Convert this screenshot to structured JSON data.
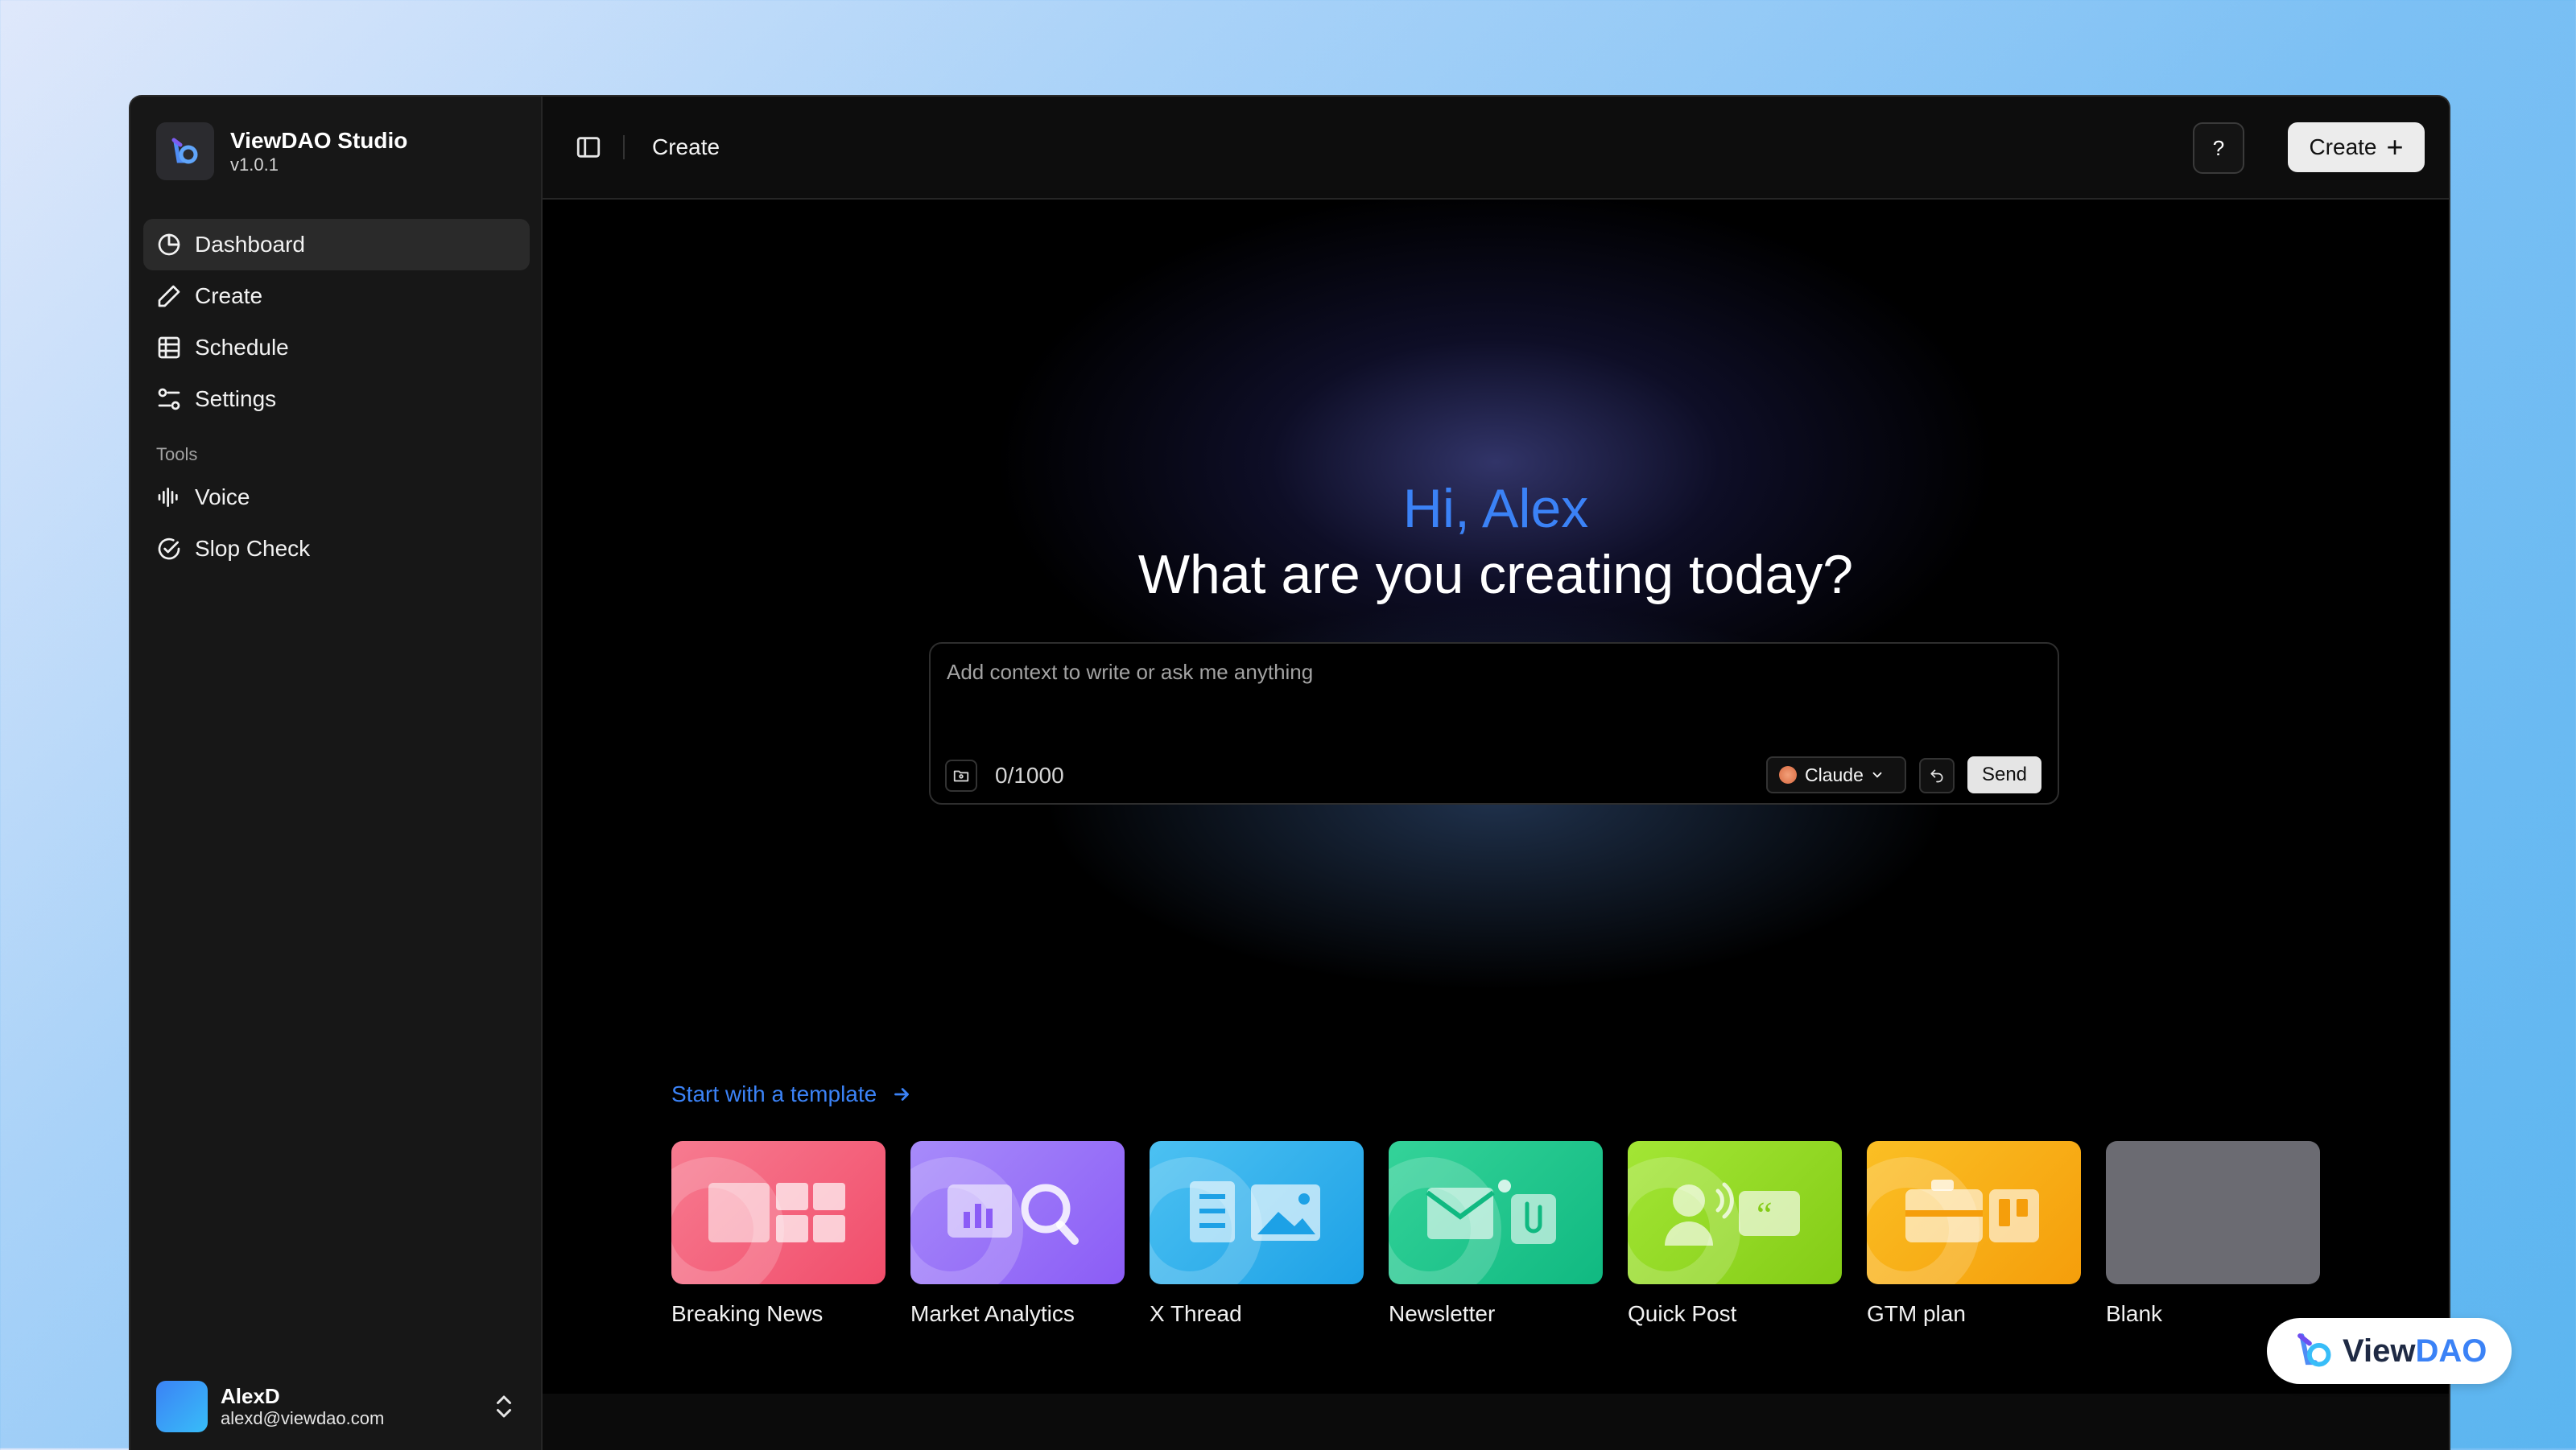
{
  "app": {
    "name": "ViewDAO Studio",
    "version": "v1.0.1"
  },
  "nav": {
    "items": [
      {
        "label": "Dashboard",
        "icon": "chart-pie-icon",
        "active": true
      },
      {
        "label": "Create",
        "icon": "pencil-icon"
      },
      {
        "label": "Schedule",
        "icon": "table-grid-icon"
      },
      {
        "label": "Settings",
        "icon": "sliders-icon"
      }
    ],
    "tools_label": "Tools",
    "tools": [
      {
        "label": "Voice",
        "icon": "waveform-icon"
      },
      {
        "label": "Slop Check",
        "icon": "check-circle-icon"
      }
    ]
  },
  "user": {
    "name": "AlexD",
    "email": "alexd@viewdao.com"
  },
  "topbar": {
    "breadcrumb": "Create",
    "help_label": "?",
    "create_label": "Create"
  },
  "hero": {
    "greeting": "Hi, Alex",
    "headline": "What are you creating today?"
  },
  "composer": {
    "placeholder": "Add context to write or ask me anything",
    "char_count": "0/1000",
    "model": "Claude",
    "send_label": "Send"
  },
  "templates": {
    "link_label": "Start with a template",
    "items": [
      {
        "label": "Breaking News",
        "color": "#f14d6b",
        "icon": "layout-icon"
      },
      {
        "label": "Market Analytics",
        "color": "#8b5cf6",
        "icon": "analytics-icon"
      },
      {
        "label": "X Thread",
        "color": "#1da1e6",
        "icon": "thread-icon"
      },
      {
        "label": "Newsletter",
        "color": "#10b981",
        "icon": "mail-icon"
      },
      {
        "label": "Quick Post",
        "color": "#84cc16",
        "icon": "speaker-icon"
      },
      {
        "label": "GTM plan",
        "color": "#f59e0b",
        "icon": "briefcase-icon"
      },
      {
        "label": "Blank",
        "color": "#6b6b72",
        "icon": ""
      }
    ]
  },
  "badge": {
    "view": "View",
    "dao": "DAO"
  },
  "colors": {
    "accent": "#3b82f6",
    "sidebar_bg": "#171717",
    "main_bg": "#000000"
  }
}
